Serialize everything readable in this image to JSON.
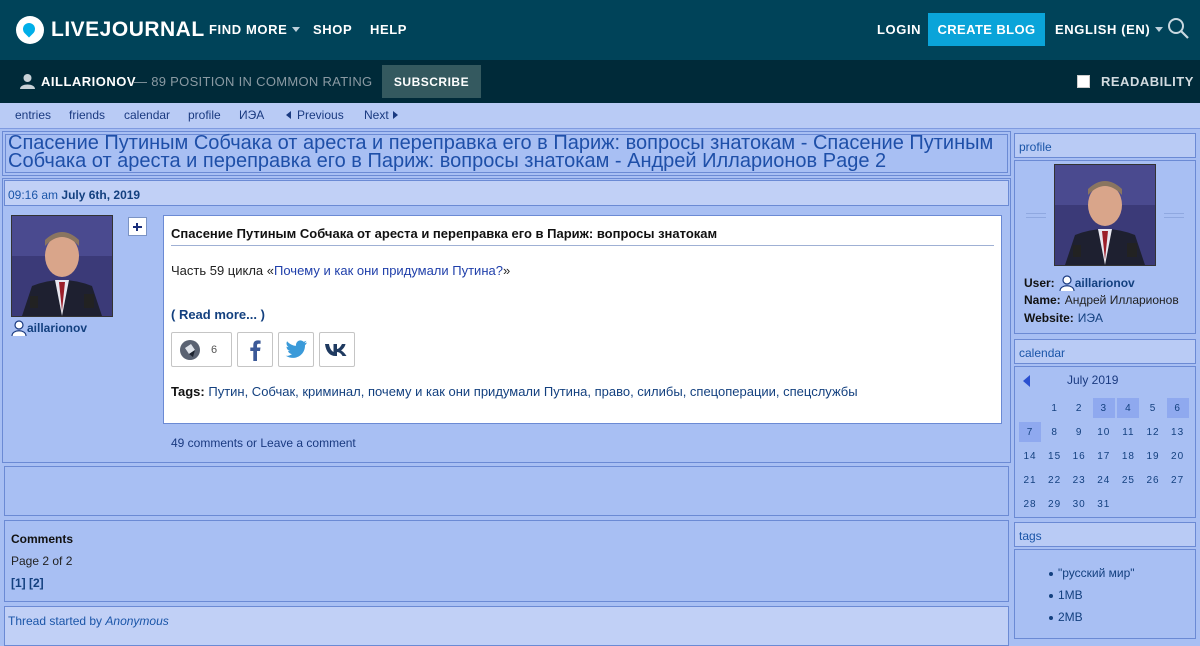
{
  "header": {
    "logo_text": "LIVEJOURNAL",
    "nav": [
      {
        "label": "FIND MORE"
      },
      {
        "label": "SHOP"
      },
      {
        "label": "HELP"
      }
    ],
    "login": "LOGIN",
    "create_blog": "CREATE BLOG",
    "language": "ENGLISH (EN)"
  },
  "subbar": {
    "username": "AILLARIONOV",
    "rating": "— 89 POSITION IN COMMON RATING",
    "subscribe": "SUBSCRIBE",
    "readability": "READABILITY"
  },
  "journal_nav": {
    "links": [
      "entries",
      "friends",
      "calendar",
      "profile",
      "ИЭА"
    ],
    "previous": "Previous",
    "next": "Next"
  },
  "page_title": "Спасение Путиным Собчака от ареста и переправка его в Париж: вопросы знатокам - Спасение Путиным Собчака от ареста и переправка его в Париж: вопросы знатокам - Андрей Илларионов Page 2",
  "entry": {
    "time": "09:16 am",
    "date": "July 6th, 2019",
    "username": "aillarionov",
    "subject": "Спасение Путиным Собчака от ареста и переправка его в Париж: вопросы знатокам",
    "text_prefix": "Часть 59 цикла «",
    "text_link": "Почему и как они придумали Путина?",
    "text_suffix": "»",
    "read_more": "( Read more... )",
    "repost_count": "6",
    "tags_label": "Tags:",
    "tags": "Путин, Собчак, криминал, почему и как они придумали Путина, право, силибы, спецоперации, спецслужбы",
    "comments_link": "49 comments or Leave a comment"
  },
  "comments": {
    "title": "Comments",
    "page": "Page 2 of 2",
    "pages": "[1] [2]",
    "thread_prefix": "Thread started by",
    "thread_author": "Anonymous"
  },
  "sidebar": {
    "profile_title": "profile",
    "user_label": "User:",
    "user_value": "aillarionov",
    "name_label": "Name:",
    "name_value": "Андрей Илларионов",
    "website_label": "Website:",
    "website_value": "ИЭА",
    "calendar_title": "calendar",
    "calendar_month": "July 2019",
    "calendar_rows": [
      [
        "",
        "1",
        "2",
        "3",
        "4",
        "5",
        "6"
      ],
      [
        "7",
        "8",
        "9",
        "10",
        "11",
        "12",
        "13"
      ],
      [
        "14",
        "15",
        "16",
        "17",
        "18",
        "19",
        "20"
      ],
      [
        "21",
        "22",
        "23",
        "24",
        "25",
        "26",
        "27"
      ],
      [
        "28",
        "29",
        "30",
        "31",
        "",
        "",
        ""
      ]
    ],
    "calendar_highlight": [
      "3",
      "4",
      "6",
      "7"
    ],
    "tags_title": "tags",
    "tag_items": [
      "\"русский мир\"",
      "1MB",
      "2MB"
    ]
  },
  "colors": {
    "header_bg": "#004359",
    "subbar_bg": "#002a39",
    "accent": "#0aa4d9",
    "page_bg": "#a8bff3",
    "link": "#13407f"
  }
}
